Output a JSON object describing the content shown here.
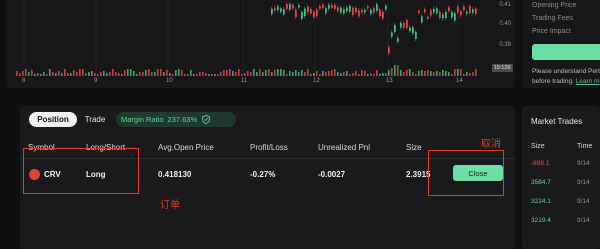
{
  "chart": {
    "price_ticks": [
      "0.41",
      "0.40",
      "0.39"
    ],
    "price_tag": "19:12K",
    "date_ticks": [
      "8",
      "9",
      "10",
      "11",
      "12",
      "13",
      "14"
    ]
  },
  "info": {
    "rows": [
      "Opening Price",
      "Trading Fees",
      "Price Impact"
    ],
    "note_line1": "Please understand Pert",
    "note_line2_prefix": "before trading.",
    "note_link": "Learn m"
  },
  "position": {
    "tabs": [
      "Position",
      "Trade"
    ],
    "margin_label": "Margin Ratio",
    "margin_value": "237.63%",
    "columns": [
      "Symbol",
      "Long/Short",
      "Avg.Open Price",
      "Profit/Loss",
      "Unrealized Pnl",
      "Size"
    ],
    "row": {
      "symbol": "CRV",
      "side": "Long",
      "avg_open_price": "0.418130",
      "profit_loss": "-0.27%",
      "unrealized_pnl": "-0.0027",
      "size": "2.3915"
    },
    "close_label": "Close"
  },
  "annotations": {
    "cancel": "取消",
    "order": "订单"
  },
  "trades": {
    "title": "Market Trades",
    "headers": [
      "Size",
      "Time"
    ],
    "rows": [
      {
        "size": "-898.1",
        "time": "9/14"
      },
      {
        "size": "3584.7",
        "time": "9/14"
      },
      {
        "size": "3224.1",
        "time": "9/14"
      },
      {
        "size": "3219.4",
        "time": "9/14"
      }
    ]
  },
  "colors": {
    "accent": "#6fe0a3",
    "positive": "#5fd496",
    "negative": "#e05050",
    "annotation": "#e03a2a"
  }
}
